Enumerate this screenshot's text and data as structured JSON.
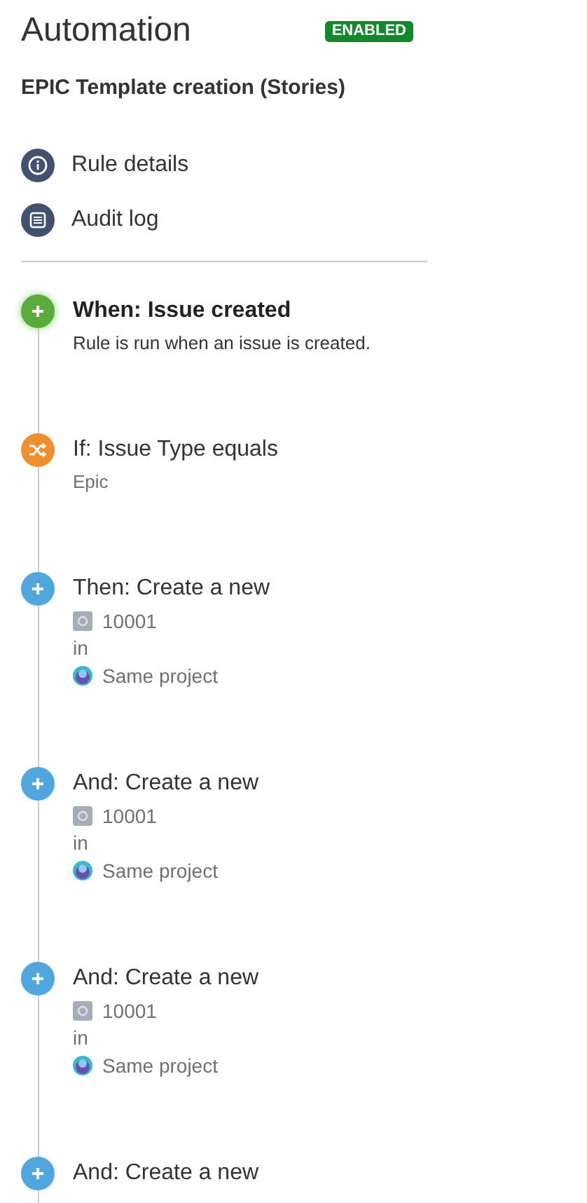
{
  "header": {
    "title": "Automation",
    "status": "ENABLED"
  },
  "rule_name": "EPIC Template creation (Stories)",
  "nav": [
    {
      "kind": "info",
      "label": "Rule details"
    },
    {
      "kind": "log",
      "label": "Audit log"
    }
  ],
  "steps": [
    {
      "kind": "trigger",
      "selected": true,
      "title": "When: Issue created",
      "description": "Rule is run when an issue is created."
    },
    {
      "kind": "condition",
      "selected": false,
      "title": "If: Issue Type equals",
      "value": "Epic"
    },
    {
      "kind": "action",
      "selected": false,
      "title": "Then: Create a new",
      "issue_type": "10001",
      "connector": "in",
      "project": "Same project"
    },
    {
      "kind": "action",
      "selected": false,
      "title": "And: Create a new",
      "issue_type": "10001",
      "connector": "in",
      "project": "Same project"
    },
    {
      "kind": "action",
      "selected": false,
      "title": "And: Create a new",
      "issue_type": "10001",
      "connector": "in",
      "project": "Same project"
    },
    {
      "kind": "action",
      "selected": false,
      "title": "And: Create a new"
    }
  ]
}
